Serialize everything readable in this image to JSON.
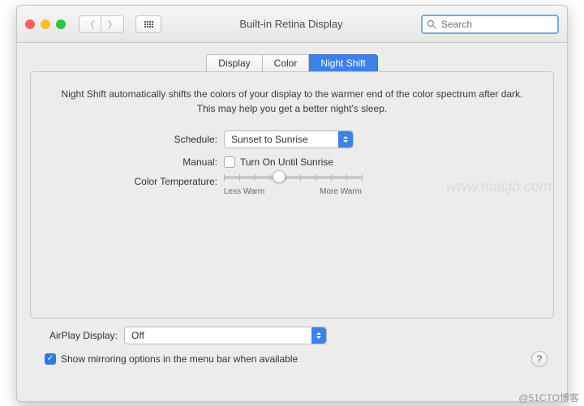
{
  "window": {
    "title": "Built-in Retina Display"
  },
  "traffic": {
    "close": "#ff5f56",
    "min": "#ffbd2e",
    "max": "#27c93f"
  },
  "search": {
    "placeholder": "Search",
    "value": ""
  },
  "tabs": [
    "Display",
    "Color",
    "Night Shift"
  ],
  "active_tab": 2,
  "panel": {
    "description": "Night Shift automatically shifts the colors of your display to the warmer end of the color spectrum after dark. This may help you get a better night's sleep.",
    "schedule": {
      "label": "Schedule:",
      "value": "Sunset to Sunrise"
    },
    "manual": {
      "label": "Manual:",
      "text": "Turn On Until Sunrise",
      "checked": false
    },
    "colortemp": {
      "label": "Color Temperature:",
      "left": "Less Warm",
      "right": "More Warm",
      "value": 0.4
    }
  },
  "airplay": {
    "label": "AirPlay Display:",
    "value": "Off"
  },
  "mirror": {
    "text": "Show mirroring options in the menu bar when available",
    "checked": true
  },
  "watermark": "www.macjb.com",
  "corner": "@51CTO博客"
}
